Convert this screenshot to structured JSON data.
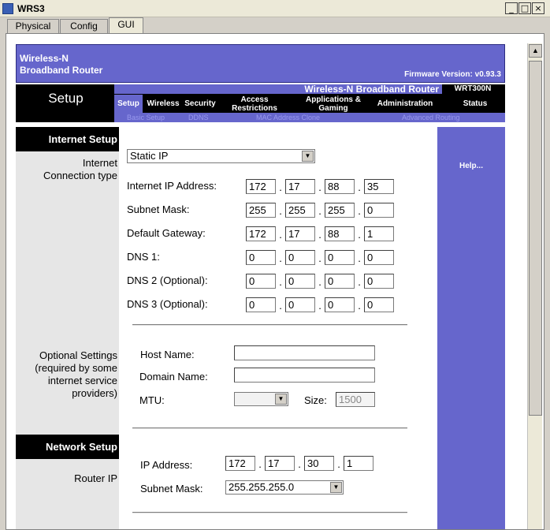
{
  "window": {
    "title": "WRS3",
    "min": "_",
    "max": "□",
    "close": "×"
  },
  "tabs": [
    {
      "label": "Physical"
    },
    {
      "label": "Config"
    },
    {
      "label": "GUI"
    }
  ],
  "banner": {
    "brand_line1": "Wireless-N",
    "brand_line2": "Broadband Router",
    "firmware": "Firmware Version: v0.93.3"
  },
  "navbar": {
    "section": "Setup",
    "product": "Wireless-N Broadband Router",
    "model": "WRT300N",
    "tabs": [
      {
        "label": "Setup"
      },
      {
        "label": "Wireless"
      },
      {
        "label": "Security"
      },
      {
        "label": "Access Restrictions"
      },
      {
        "label": "Applications & Gaming"
      },
      {
        "label": "Administration"
      },
      {
        "label": "Status"
      }
    ],
    "subtabs": [
      {
        "label": "Basic Setup"
      },
      {
        "label": "DDNS"
      },
      {
        "label": "MAC Address Clone"
      },
      {
        "label": "Advanced Routing"
      }
    ]
  },
  "sidebar": {
    "internet_setup": "Internet Setup",
    "internet_conn_type_1": "Internet",
    "internet_conn_type_2": "Connection type",
    "optional_1": "Optional Settings",
    "optional_2": "(required by some",
    "optional_3": "internet service",
    "optional_4": "providers)",
    "network_setup": "Network Setup",
    "router_ip": "Router IP"
  },
  "help": "Help...",
  "internet": {
    "connection_type": "Static IP",
    "ip_label": "Internet IP Address:",
    "ip": [
      "172",
      "17",
      "88",
      "35"
    ],
    "mask_label": "Subnet Mask:",
    "mask": [
      "255",
      "255",
      "255",
      "0"
    ],
    "gw_label": "Default Gateway:",
    "gw": [
      "172",
      "17",
      "88",
      "1"
    ],
    "dns1_label": "DNS 1:",
    "dns1": [
      "0",
      "0",
      "0",
      "0"
    ],
    "dns2_label": "DNS 2 (Optional):",
    "dns2": [
      "0",
      "0",
      "0",
      "0"
    ],
    "dns3_label": "DNS 3 (Optional):",
    "dns3": [
      "0",
      "0",
      "0",
      "0"
    ],
    "dot": "."
  },
  "optional": {
    "host_label": "Host Name:",
    "host": "",
    "domain_label": "Domain Name:",
    "domain": "",
    "mtu_label": "MTU:",
    "mtu_value": "",
    "size_label": "Size:",
    "size_value": "1500"
  },
  "network": {
    "ip_label": "IP Address:",
    "ip": [
      "172",
      "17",
      "30",
      "1"
    ],
    "mask_label": "Subnet Mask:",
    "mask_value": "255.255.255.0"
  },
  "icons": {
    "dropdown": "▼",
    "scroll_up": "▲",
    "scroll_down": "▼"
  }
}
